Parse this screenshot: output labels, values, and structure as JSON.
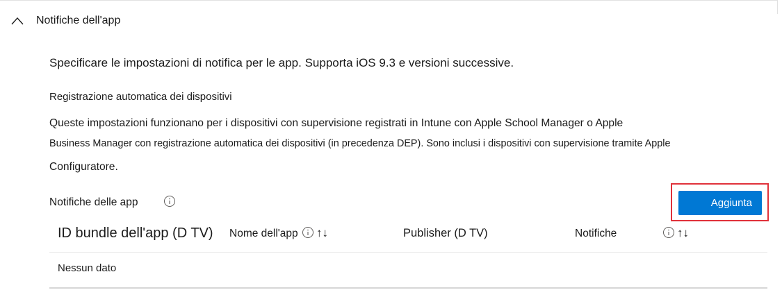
{
  "section": {
    "title": "Notifiche dell'app",
    "collapse_icon": "chevron-up-icon"
  },
  "intro_text": "Specificare le impostazioni di notifica per le app. Supporta iOS 9.3 e versioni successive.",
  "ade": {
    "heading": "Registrazione automatica dei dispositivi",
    "line1": "Queste impostazioni funzionano per i dispositivi con supervisione registrati in Intune con Apple School Manager o Apple",
    "line2": "Business Manager con registrazione automatica dei dispositivi (in precedenza DEP). Sono inclusi i dispositivi con supervisione tramite Apple",
    "line3": "Configuratore."
  },
  "app_notifications": {
    "label": "Notifiche delle app",
    "info_icon": "info-icon",
    "add_button_label": "Aggiunta",
    "highlight_color": "#e0313a",
    "accent_color": "#0078d4",
    "columns": [
      {
        "label": "ID bundle dell'app (D TV)"
      },
      {
        "label": "Nome dell'app",
        "info_icon": "info-icon",
        "sort_icon": "↑↓"
      },
      {
        "label": "Publisher (D TV)"
      },
      {
        "label": "Notifiche",
        "info_icon": "info-icon",
        "sort_icon": "↑↓"
      }
    ],
    "empty_message": "Nessun dato"
  }
}
